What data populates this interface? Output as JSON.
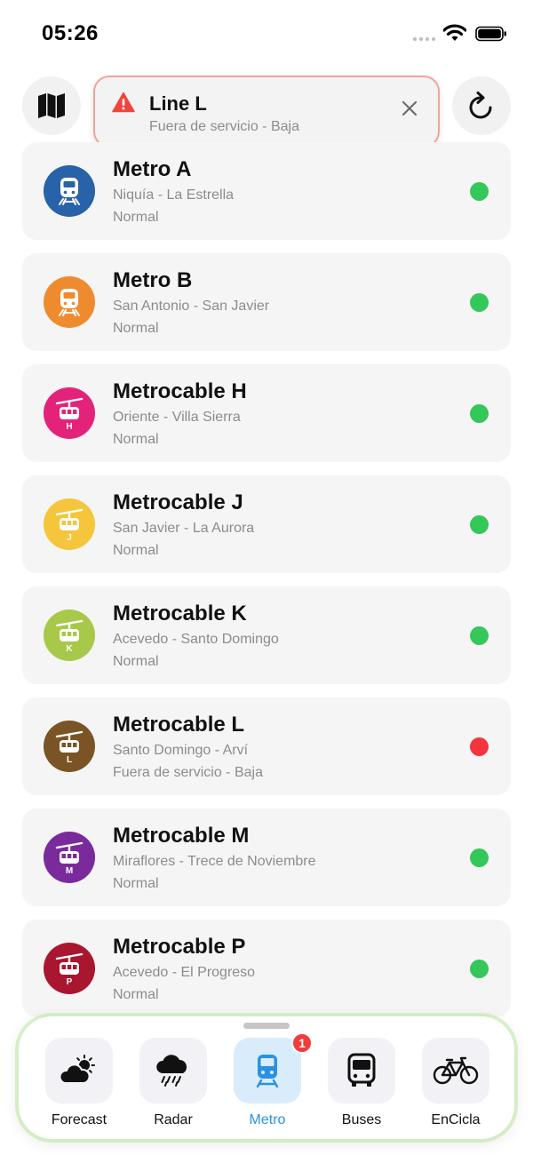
{
  "status_bar": {
    "time": "05:26"
  },
  "alert": {
    "title": "Line L",
    "subtitle": "Fuera de servicio - Baja",
    "icon": "warning-icon"
  },
  "controls": {
    "map_icon": "map-icon",
    "refresh_icon": "refresh-icon",
    "close_icon": "close-icon"
  },
  "lines": [
    {
      "name": "Metro A",
      "route": "Niquía - La Estrella",
      "status": "Normal",
      "badge_color": "#2862a8",
      "kind": "metro",
      "letter": "",
      "status_color": "#34c759"
    },
    {
      "name": "Metro B",
      "route": "San Antonio - San Javier",
      "status": "Normal",
      "badge_color": "#ef8b2f",
      "kind": "metro",
      "letter": "",
      "status_color": "#34c759"
    },
    {
      "name": "Metrocable H",
      "route": "Oriente - Villa Sierra",
      "status": "Normal",
      "badge_color": "#e3237a",
      "kind": "cable",
      "letter": "H",
      "status_color": "#34c759"
    },
    {
      "name": "Metrocable J",
      "route": "San Javier - La Aurora",
      "status": "Normal",
      "badge_color": "#f5c53c",
      "kind": "cable",
      "letter": "J",
      "status_color": "#34c759"
    },
    {
      "name": "Metrocable K",
      "route": "Acevedo - Santo Domingo",
      "status": "Normal",
      "badge_color": "#a8c84a",
      "kind": "cable",
      "letter": "K",
      "status_color": "#34c759"
    },
    {
      "name": "Metrocable L",
      "route": "Santo Domingo - Arví",
      "status": "Fuera de servicio - Baja",
      "badge_color": "#7a5424",
      "kind": "cable",
      "letter": "L",
      "status_color": "#f3353f"
    },
    {
      "name": "Metrocable M",
      "route": "Miraflores - Trece de Noviembre",
      "status": "Normal",
      "badge_color": "#7b2a9c",
      "kind": "cable",
      "letter": "M",
      "status_color": "#34c759"
    },
    {
      "name": "Metrocable P",
      "route": "Acevedo - El Progreso",
      "status": "Normal",
      "badge_color": "#a8172f",
      "kind": "cable",
      "letter": "P",
      "status_color": "#34c759"
    }
  ],
  "tabs": [
    {
      "label": "Forecast",
      "icon": "partly-sunny-icon",
      "active": false
    },
    {
      "label": "Radar",
      "icon": "rain-cloud-icon",
      "active": false
    },
    {
      "label": "Metro",
      "icon": "tram-icon",
      "active": true,
      "badge": "1"
    },
    {
      "label": "Buses",
      "icon": "bus-icon",
      "active": false
    },
    {
      "label": "EnCicla",
      "icon": "bicycle-icon",
      "active": false
    }
  ],
  "colors": {
    "accent": "#2b91e3",
    "alert_border": "#f2a398",
    "status_ok": "#34c759",
    "status_down": "#f3353f"
  }
}
